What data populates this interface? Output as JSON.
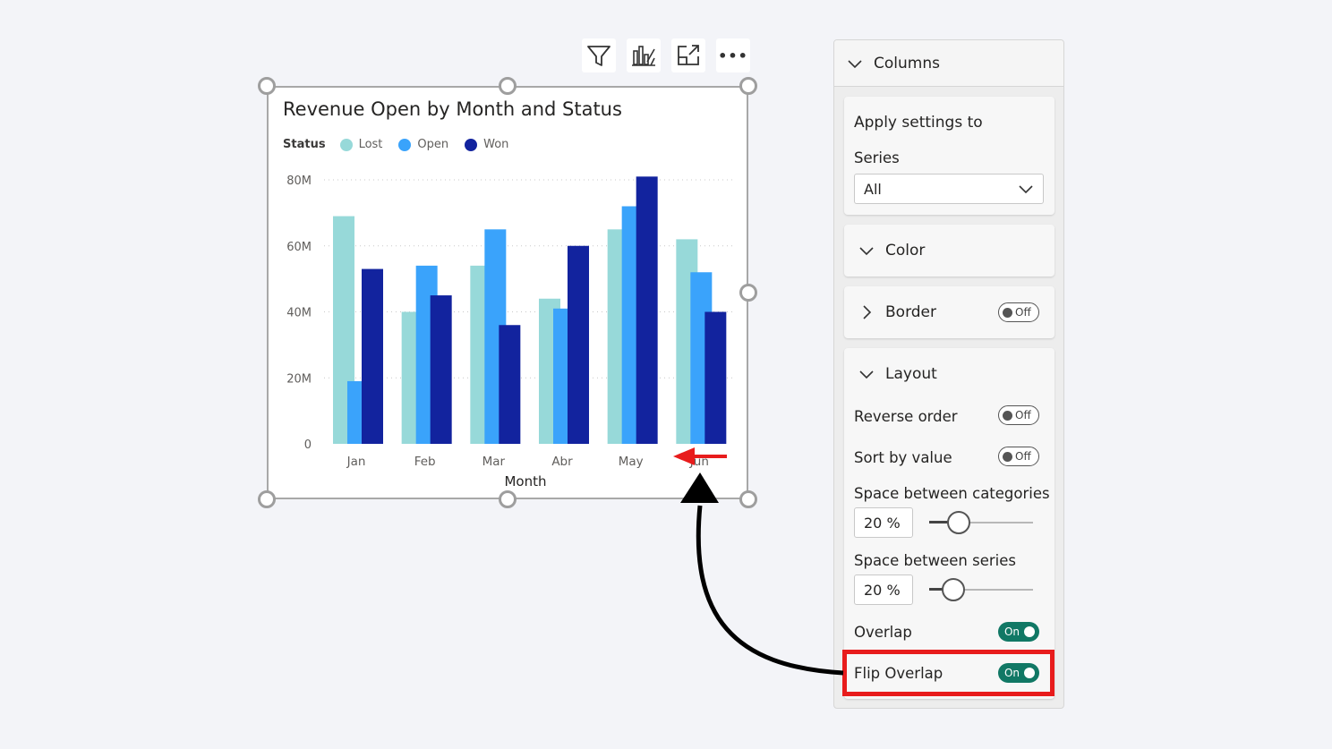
{
  "toolbar": {
    "icons": [
      "filter-icon",
      "analytics-icon",
      "focus-mode-icon",
      "more-options-icon"
    ],
    "more_label": "•••"
  },
  "chart": {
    "title": "Revenue Open by Month and Status",
    "legend_title": "Status",
    "legend": [
      {
        "label": "Lost",
        "color": "#97d9d9"
      },
      {
        "label": "Open",
        "color": "#3aa3fb"
      },
      {
        "label": "Won",
        "color": "#12239e"
      }
    ]
  },
  "chart_data": {
    "type": "bar",
    "title": "Revenue Open by Month and Status",
    "xlabel": "Month",
    "ylabel": "",
    "categories": [
      "Jan",
      "Feb",
      "Mar",
      "Abr",
      "May",
      "Jun"
    ],
    "y_ticks": [
      "0",
      "20M",
      "40M",
      "60M",
      "80M"
    ],
    "ylim": [
      0,
      80
    ],
    "grid": true,
    "legend_position": "top-left",
    "series": [
      {
        "name": "Lost",
        "color": "#97d9d9",
        "values": [
          69,
          40,
          54,
          44,
          65,
          62
        ]
      },
      {
        "name": "Open",
        "color": "#3aa3fb",
        "values": [
          19,
          54,
          65,
          41,
          72,
          52
        ]
      },
      {
        "name": "Won",
        "color": "#12239e",
        "values": [
          53,
          45,
          36,
          60,
          81,
          40
        ]
      }
    ]
  },
  "pane": {
    "section": "Columns",
    "apply": {
      "title": "Apply settings to",
      "series_label": "Series",
      "series_value": "All"
    },
    "color": {
      "title": "Color"
    },
    "border": {
      "title": "Border",
      "toggle": "Off"
    },
    "layout": {
      "title": "Layout",
      "reverse_order": {
        "label": "Reverse order",
        "toggle": "Off"
      },
      "sort_by_value": {
        "label": "Sort by value",
        "toggle": "Off"
      },
      "space_categories": {
        "label": "Space between categories",
        "value": "20 %",
        "slider": 0.22
      },
      "space_series": {
        "label": "Space between series",
        "value": "20 %",
        "slider": 0.15
      },
      "overlap": {
        "label": "Overlap",
        "toggle": "On"
      },
      "flip_overlap": {
        "label": "Flip Overlap",
        "toggle": "On"
      }
    }
  },
  "colors": {
    "accent_toggle": "#117865",
    "highlight": "#e81c1c",
    "red_arrow": "#e81c1c",
    "black_arrow": "#000000"
  }
}
